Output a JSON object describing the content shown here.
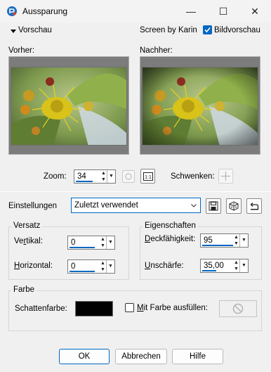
{
  "window": {
    "title": "Aussparung",
    "minimize_glyph": "—",
    "maximize_glyph": "☐",
    "close_glyph": "✕"
  },
  "preview": {
    "toggle_label": "Vorschau",
    "credit": "Screen by Karin",
    "bildvorschau_label": "Bildvorschau",
    "bildvorschau_checked": true,
    "before_label": "Vorher:",
    "after_label": "Nachher:",
    "zoom_label": "Zoom:",
    "zoom_value": "34",
    "pan_label": "Schwenken:"
  },
  "settings": {
    "label": "Einstellungen",
    "preset": "Zuletzt verwendet"
  },
  "versatz": {
    "title": "Versatz",
    "vertical_prefix": "Ve",
    "vertical_accel": "r",
    "vertical_suffix": "tikal:",
    "vertical_value": "0",
    "horizontal_accel": "H",
    "horizontal_suffix": "orizontal:",
    "horizontal_value": "0"
  },
  "eigenschaften": {
    "title": "Eigenschaften",
    "opacity_accel": "D",
    "opacity_suffix": "eckfähigkeit:",
    "opacity_value": "95",
    "blur_accel": "U",
    "blur_suffix": "nschärfe:",
    "blur_value": "35,00"
  },
  "farbe": {
    "title": "Farbe",
    "shadow_label": "Schattenfarbe:",
    "shadow_color": "#000000",
    "fill_accel": "M",
    "fill_suffix": "it Farbe ausfüllen:",
    "fill_checked": false
  },
  "buttons": {
    "ok": "OK",
    "cancel": "Abbrechen",
    "help": "Hilfe"
  },
  "colors": {
    "accent": "#0067c0"
  }
}
